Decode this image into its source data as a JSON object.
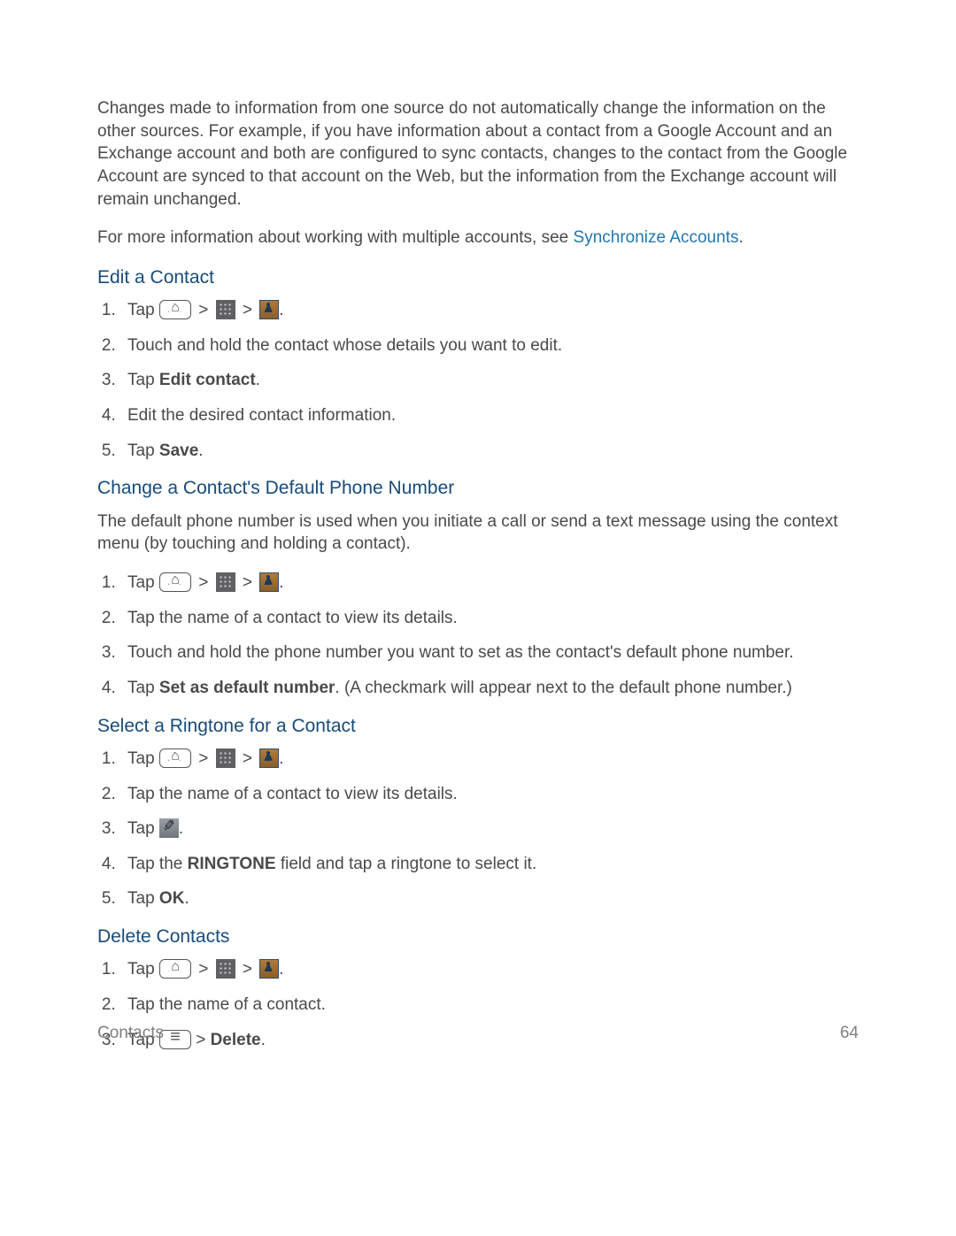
{
  "intro": {
    "p1": "Changes made to information from one source do not automatically change the information on the other sources. For example, if you have information about a contact from a Google Account and an Exchange account and both are configured to sync contacts, changes to the contact from the Google Account are synced to that account on the Web, but the information from the Exchange account will remain unchanged.",
    "p2_prefix": "For more information about working with multiple accounts, see ",
    "p2_link": "Synchronize Accounts",
    "p2_suffix": "."
  },
  "sections": {
    "edit": {
      "heading": "Edit a Contact",
      "step1": {
        "tap": "Tap ",
        "period": "."
      },
      "step2": "Touch and hold the contact whose details you want to edit.",
      "step3": {
        "prefix": "Tap ",
        "bold": "Edit contact",
        "suffix": "."
      },
      "step4": "Edit the desired contact information.",
      "step5": {
        "prefix": "Tap ",
        "bold": "Save",
        "suffix": "."
      }
    },
    "default_number": {
      "heading": "Change a Contact's Default Phone Number",
      "intro": "The default phone number is used when you initiate a call or send a text message using the context menu (by touching and holding a contact).",
      "step1": {
        "tap": "Tap ",
        "period": "."
      },
      "step2": "Tap the name of a contact to view its details.",
      "step3": "Touch and hold the phone number you want to set as the contact's default phone number.",
      "step4": {
        "prefix": "Tap ",
        "bold": "Set as default number",
        "suffix": ". (A checkmark will appear next to the default phone number.)"
      }
    },
    "ringtone": {
      "heading": "Select a Ringtone for a Contact",
      "step1": {
        "tap": "Tap ",
        "period": "."
      },
      "step2": "Tap the name of a contact to view its details.",
      "step3": {
        "tap": "Tap ",
        "period": "."
      },
      "step4": {
        "prefix": "Tap the ",
        "bold": "RINGTONE",
        "suffix": " field and tap a ringtone to select it."
      },
      "step5": {
        "prefix": "Tap ",
        "bold": "OK",
        "suffix": "."
      }
    },
    "delete": {
      "heading": "Delete Contacts",
      "step1": {
        "tap": "Tap ",
        "period": "."
      },
      "step2": "Tap the name of a contact.",
      "step3": {
        "tap": "Tap ",
        "sep": " > ",
        "bold": "Delete",
        "suffix": "."
      }
    }
  },
  "separator": " > ",
  "footer": {
    "section": "Contacts",
    "page": "64"
  }
}
